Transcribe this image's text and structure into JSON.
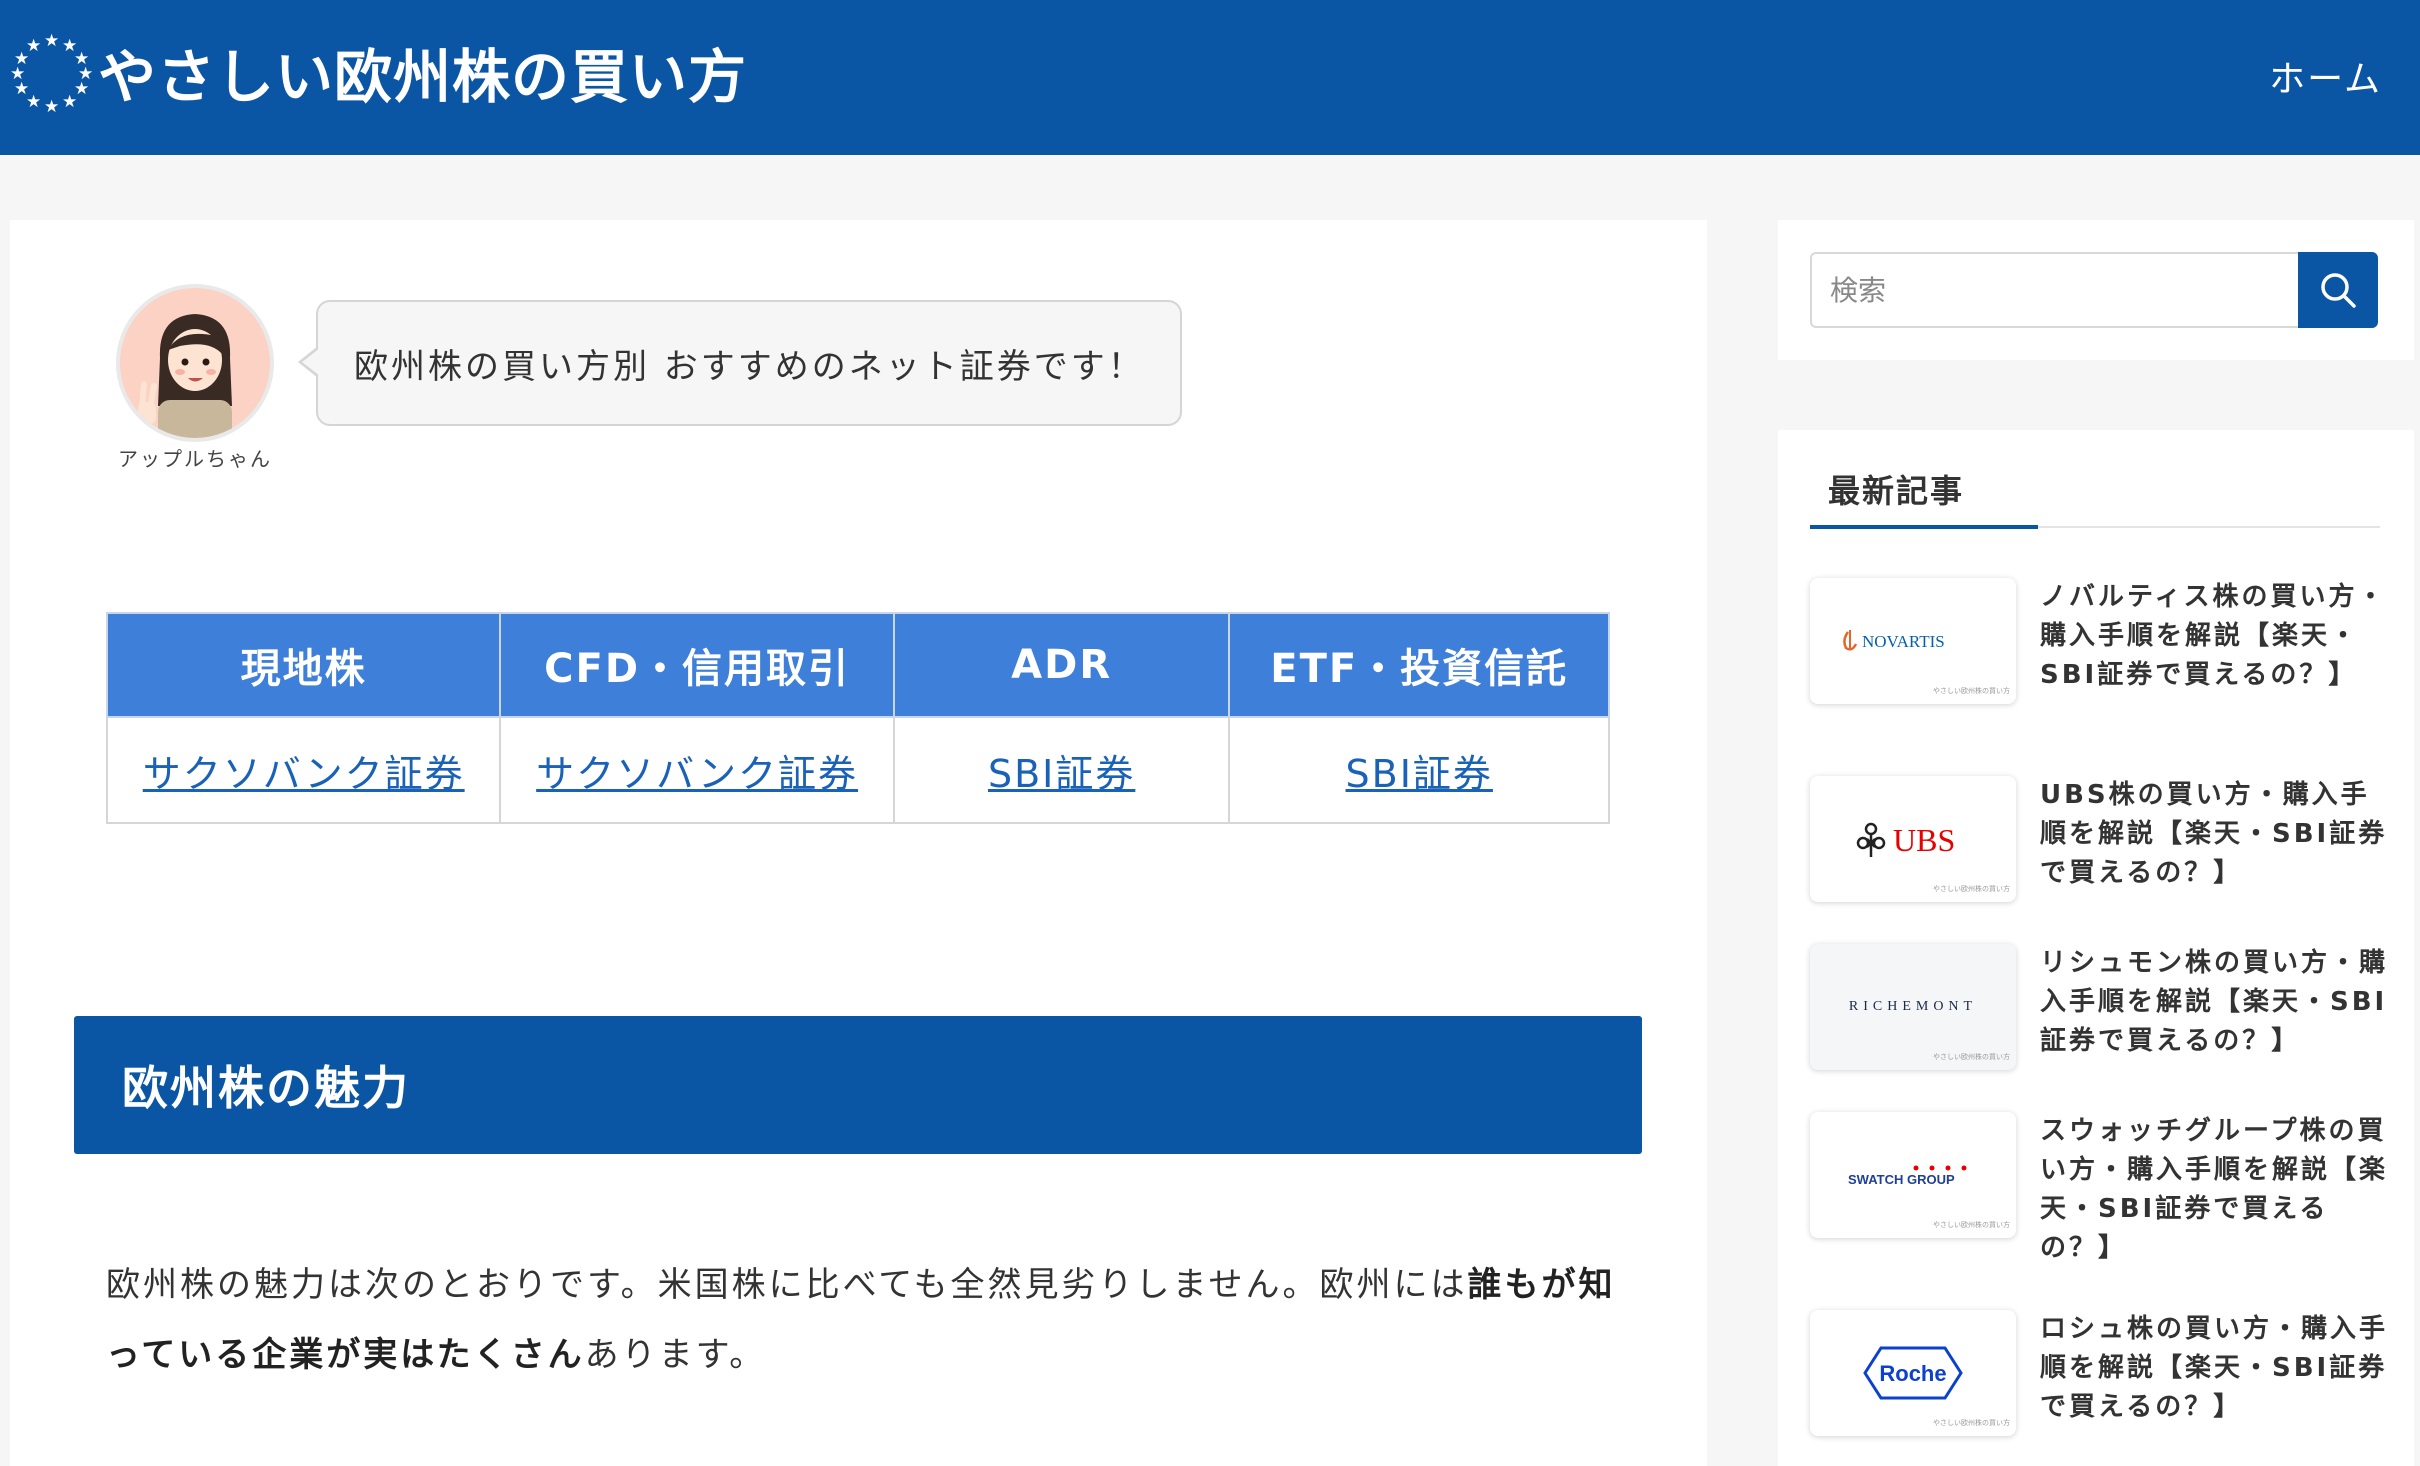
{
  "header": {
    "site_title": "やさしい欧州株の買い方",
    "nav_home": "ホーム"
  },
  "speech": {
    "avatar_name": "アップルちゃん",
    "text": "欧州株の買い方別 おすすめのネット証券です！"
  },
  "broker_table": {
    "headers": [
      "現地株",
      "CFD・信用取引",
      "ADR",
      "ETF・投資信託"
    ],
    "links": [
      "サクソバンク証券",
      "サクソバンク証券",
      "SBI証券",
      "SBI証券"
    ]
  },
  "section": {
    "heading": "欧州株の魅力",
    "intro_plain_1": "欧州株の魅力は次のとおりです。米国株に比べても全然見劣りしません。欧州には",
    "intro_bold": "誰もが知っている企業が実はたくさん",
    "intro_plain_2": "あります。"
  },
  "sidebar": {
    "search_placeholder": "検索",
    "recent_title": "最新記事",
    "posts": [
      {
        "title": "ノバルティス株の買い方・購入手順を解説【楽天・SBI証券で買えるの？】",
        "logo": "NOVARTIS",
        "logo_color": "#0460a9"
      },
      {
        "title": "UBS株の買い方・購入手順を解説【楽天・SBI証券で買えるの？】",
        "logo": "UBS",
        "logo_color": "#e60000"
      },
      {
        "title": "リシュモン株の買い方・購入手順を解説【楽天・SBI証券で買えるの？】",
        "logo": "RICHEMONT",
        "logo_color": "#1a2a4a"
      },
      {
        "title": "スウォッチグループ株の買い方・購入手順を解説【楽天・SBI証券で買えるの？】",
        "logo": "SWATCH GROUP",
        "logo_color": "#1f3f99"
      },
      {
        "title": "ロシュ株の買い方・購入手順を解説【楽天・SBI証券で買えるの？】",
        "logo": "Roche",
        "logo_color": "#0b41cd"
      }
    ]
  },
  "colors": {
    "brand_blue": "#0b56a4",
    "table_header_blue": "#3d7fd9",
    "link_blue": "#1a62b8"
  }
}
